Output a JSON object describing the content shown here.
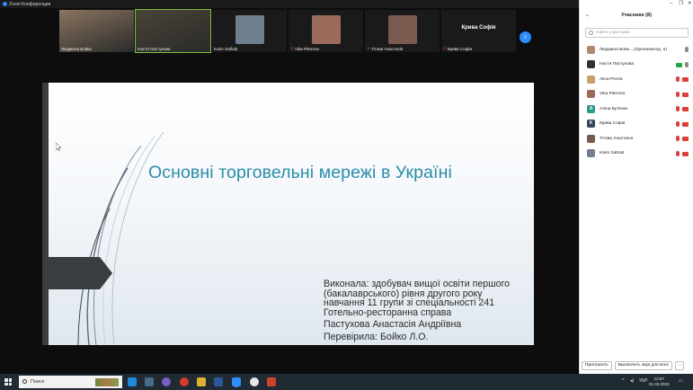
{
  "window": {
    "title": "Zoom Конференция"
  },
  "thumbnails": [
    {
      "name": "Людмила Бойко",
      "kind": "video",
      "color": "#8a7560",
      "active": false,
      "muted": false
    },
    {
      "name": "Настя Пастухова",
      "kind": "video",
      "color": "#4a4438",
      "active": true,
      "muted": false
    },
    {
      "name": "Karin Salhab",
      "kind": "photo",
      "color": "#6f7f8e",
      "active": false,
      "muted": false
    },
    {
      "name": "Vika Piterova",
      "kind": "photo",
      "color": "#9a6a5a",
      "active": false,
      "muted": true
    },
    {
      "name": "Тітова Анастасія",
      "kind": "photo",
      "color": "#7a5a4e",
      "active": false,
      "muted": true
    },
    {
      "name": "Крива Софія",
      "kind": "name",
      "color": "#1a1a1a",
      "active": false,
      "muted": true
    }
  ],
  "slide": {
    "title": "Основні торговельні мережі в Україні",
    "body_lines": [
      "Виконала: здобувач вищої освіти першого",
      "(бакалаврського) рівня другого року",
      "навчання 11 групи зі спеціальності 241",
      "Готельно-ресторанна справа",
      "Пастухова Анастасія Андріївна",
      "Перевірила: Бойко Л.О."
    ],
    "accent_color": "#2a8ea8"
  },
  "panel": {
    "title": "Учасники (8)",
    "search_placeholder": "Найти участника",
    "participants": [
      {
        "name": "Людмила Бойк...  (Организатор, я)",
        "avatar_color": "#b08a70",
        "initial": "",
        "mic_on": true,
        "cam_on": true
      },
      {
        "name": "Настя Пастухова",
        "avatar_color": "#3a3028",
        "initial": "",
        "mic_on": true,
        "cam_on": true
      },
      {
        "name": "Alina Penza",
        "avatar_color": "#c9a06a",
        "initial": "",
        "mic_on": false,
        "cam_on": false
      },
      {
        "name": "Vika Piterova",
        "avatar_color": "#9a6a5a",
        "initial": "",
        "mic_on": false,
        "cam_on": false
      },
      {
        "name": "Аліна Бутенко",
        "avatar_color": "#2a9a8a",
        "initial": "А",
        "mic_on": false,
        "cam_on": false
      },
      {
        "name": "Крива Софія",
        "avatar_color": "#34465a",
        "initial": "К",
        "mic_on": false,
        "cam_on": false
      },
      {
        "name": "Тітова Анастасія",
        "avatar_color": "#7a5a4e",
        "initial": "",
        "mic_on": false,
        "cam_on": false
      },
      {
        "name": "Karin Salhab",
        "avatar_color": "#6f7f8e",
        "initial": "",
        "mic_on": false,
        "cam_on": false
      }
    ],
    "invite_label": "Пригласить",
    "mute_all_label": "Выключить звук для всех",
    "more_label": "…"
  },
  "taskbar": {
    "search_placeholder": "Поиск",
    "language": "УКР",
    "time": "12:57",
    "date": "01.03.2023"
  }
}
